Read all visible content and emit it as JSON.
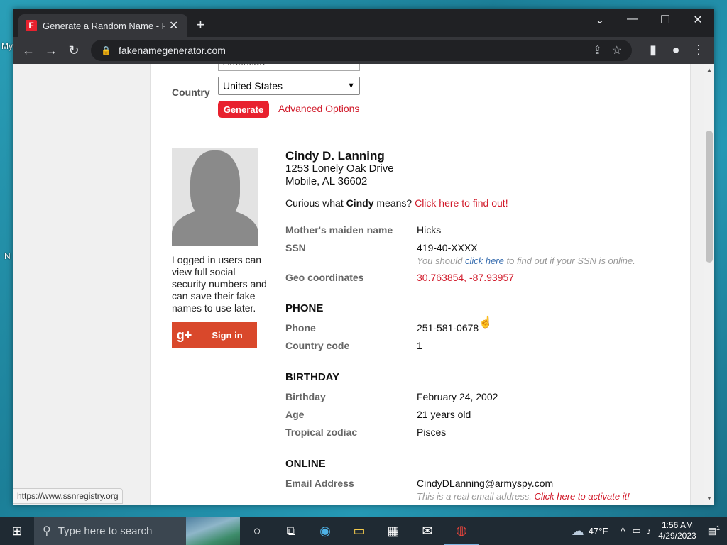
{
  "desktop": {
    "labels": [
      "My",
      "N"
    ]
  },
  "browser": {
    "tab_title": "Generate a Random Name - Fake",
    "tab_favicon_letter": "F",
    "url": "fakenamegenerator.com",
    "status_url": "https://www.ssnregistry.org"
  },
  "form": {
    "prev_select_value": "American",
    "country_label": "Country",
    "country_value": "United States",
    "generate_label": "Generate",
    "advanced_label": "Advanced Options"
  },
  "sidebar": {
    "login_text": "Logged in users can view full social security numbers and can save their fake names to use later.",
    "gplus_label": "g+",
    "signin_label": "Sign in"
  },
  "identity": {
    "name": "Cindy D. Lanning",
    "address_line1": "1253 Lonely Oak Drive",
    "address_line2": "Mobile, AL 36602",
    "curious_prefix": "Curious what ",
    "curious_name": "Cindy",
    "curious_suffix": " means? ",
    "curious_link": "Click here to find out!"
  },
  "details": {
    "maiden_label": "Mother's maiden name",
    "maiden_value": "Hicks",
    "ssn_label": "SSN",
    "ssn_value": "419-40-XXXX",
    "ssn_note_prefix": "You should ",
    "ssn_note_link": "click here",
    "ssn_note_suffix": " to find out if your SSN is online.",
    "geo_label": "Geo coordinates",
    "geo_value": "30.763854, -87.93957"
  },
  "phone": {
    "section": "PHONE",
    "phone_label": "Phone",
    "phone_value": "251-581-0678",
    "cc_label": "Country code",
    "cc_value": "1"
  },
  "birthday": {
    "section": "BIRTHDAY",
    "bday_label": "Birthday",
    "bday_value": "February 24, 2002",
    "age_label": "Age",
    "age_value": "21 years old",
    "zodiac_label": "Tropical zodiac",
    "zodiac_value": "Pisces"
  },
  "online": {
    "section": "ONLINE",
    "email_label": "Email Address",
    "email_value": "CindyDLanning@armyspy.com",
    "email_note": "This is a real email address. ",
    "email_link": "Click here to activate it!"
  },
  "taskbar": {
    "search_placeholder": "Type here to search",
    "weather": "47°F",
    "time": "1:56 AM",
    "date": "4/29/2023",
    "notification_count": "1"
  }
}
